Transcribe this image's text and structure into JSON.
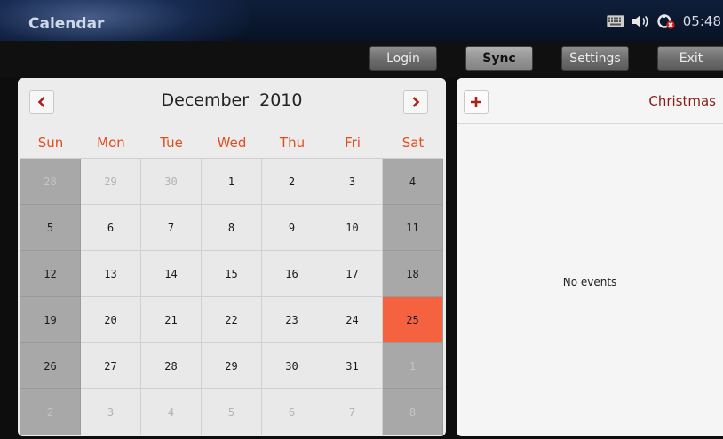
{
  "app": {
    "title": "Calendar"
  },
  "status_bar": {
    "time": "05:48",
    "icons": [
      "keyboard-icon",
      "volume-icon",
      "network-off-icon"
    ]
  },
  "toolbar": {
    "login_label": "Login",
    "sync_label": "Sync",
    "settings_label": "Settings",
    "exit_label": "Exit"
  },
  "calendar": {
    "month_title": "December  2010",
    "weekdays": [
      "Sun",
      "Mon",
      "Tue",
      "Wed",
      "Thu",
      "Fri",
      "Sat"
    ],
    "weeks": [
      [
        {
          "d": "28",
          "o": true
        },
        {
          "d": "29",
          "o": true
        },
        {
          "d": "30",
          "o": true
        },
        {
          "d": "1"
        },
        {
          "d": "2"
        },
        {
          "d": "3"
        },
        {
          "d": "4"
        }
      ],
      [
        {
          "d": "5"
        },
        {
          "d": "6"
        },
        {
          "d": "7"
        },
        {
          "d": "8"
        },
        {
          "d": "9"
        },
        {
          "d": "10"
        },
        {
          "d": "11"
        }
      ],
      [
        {
          "d": "12"
        },
        {
          "d": "13"
        },
        {
          "d": "14"
        },
        {
          "d": "15"
        },
        {
          "d": "16"
        },
        {
          "d": "17"
        },
        {
          "d": "18"
        }
      ],
      [
        {
          "d": "19"
        },
        {
          "d": "20"
        },
        {
          "d": "21"
        },
        {
          "d": "22"
        },
        {
          "d": "23"
        },
        {
          "d": "24"
        },
        {
          "d": "25",
          "sel": true
        }
      ],
      [
        {
          "d": "26"
        },
        {
          "d": "27"
        },
        {
          "d": "28"
        },
        {
          "d": "29"
        },
        {
          "d": "30"
        },
        {
          "d": "31"
        },
        {
          "d": "1",
          "o": true
        }
      ],
      [
        {
          "d": "2",
          "o": true
        },
        {
          "d": "3",
          "o": true
        },
        {
          "d": "4",
          "o": true
        },
        {
          "d": "5",
          "o": true
        },
        {
          "d": "6",
          "o": true
        },
        {
          "d": "7",
          "o": true
        },
        {
          "d": "8",
          "o": true
        }
      ]
    ],
    "colors": {
      "weekday_header": "#e24d1f",
      "selected": "#f4623f",
      "weekend": "#a8a8a8"
    }
  },
  "events": {
    "selected_day_label": "Christmas",
    "empty_text": "No events"
  }
}
